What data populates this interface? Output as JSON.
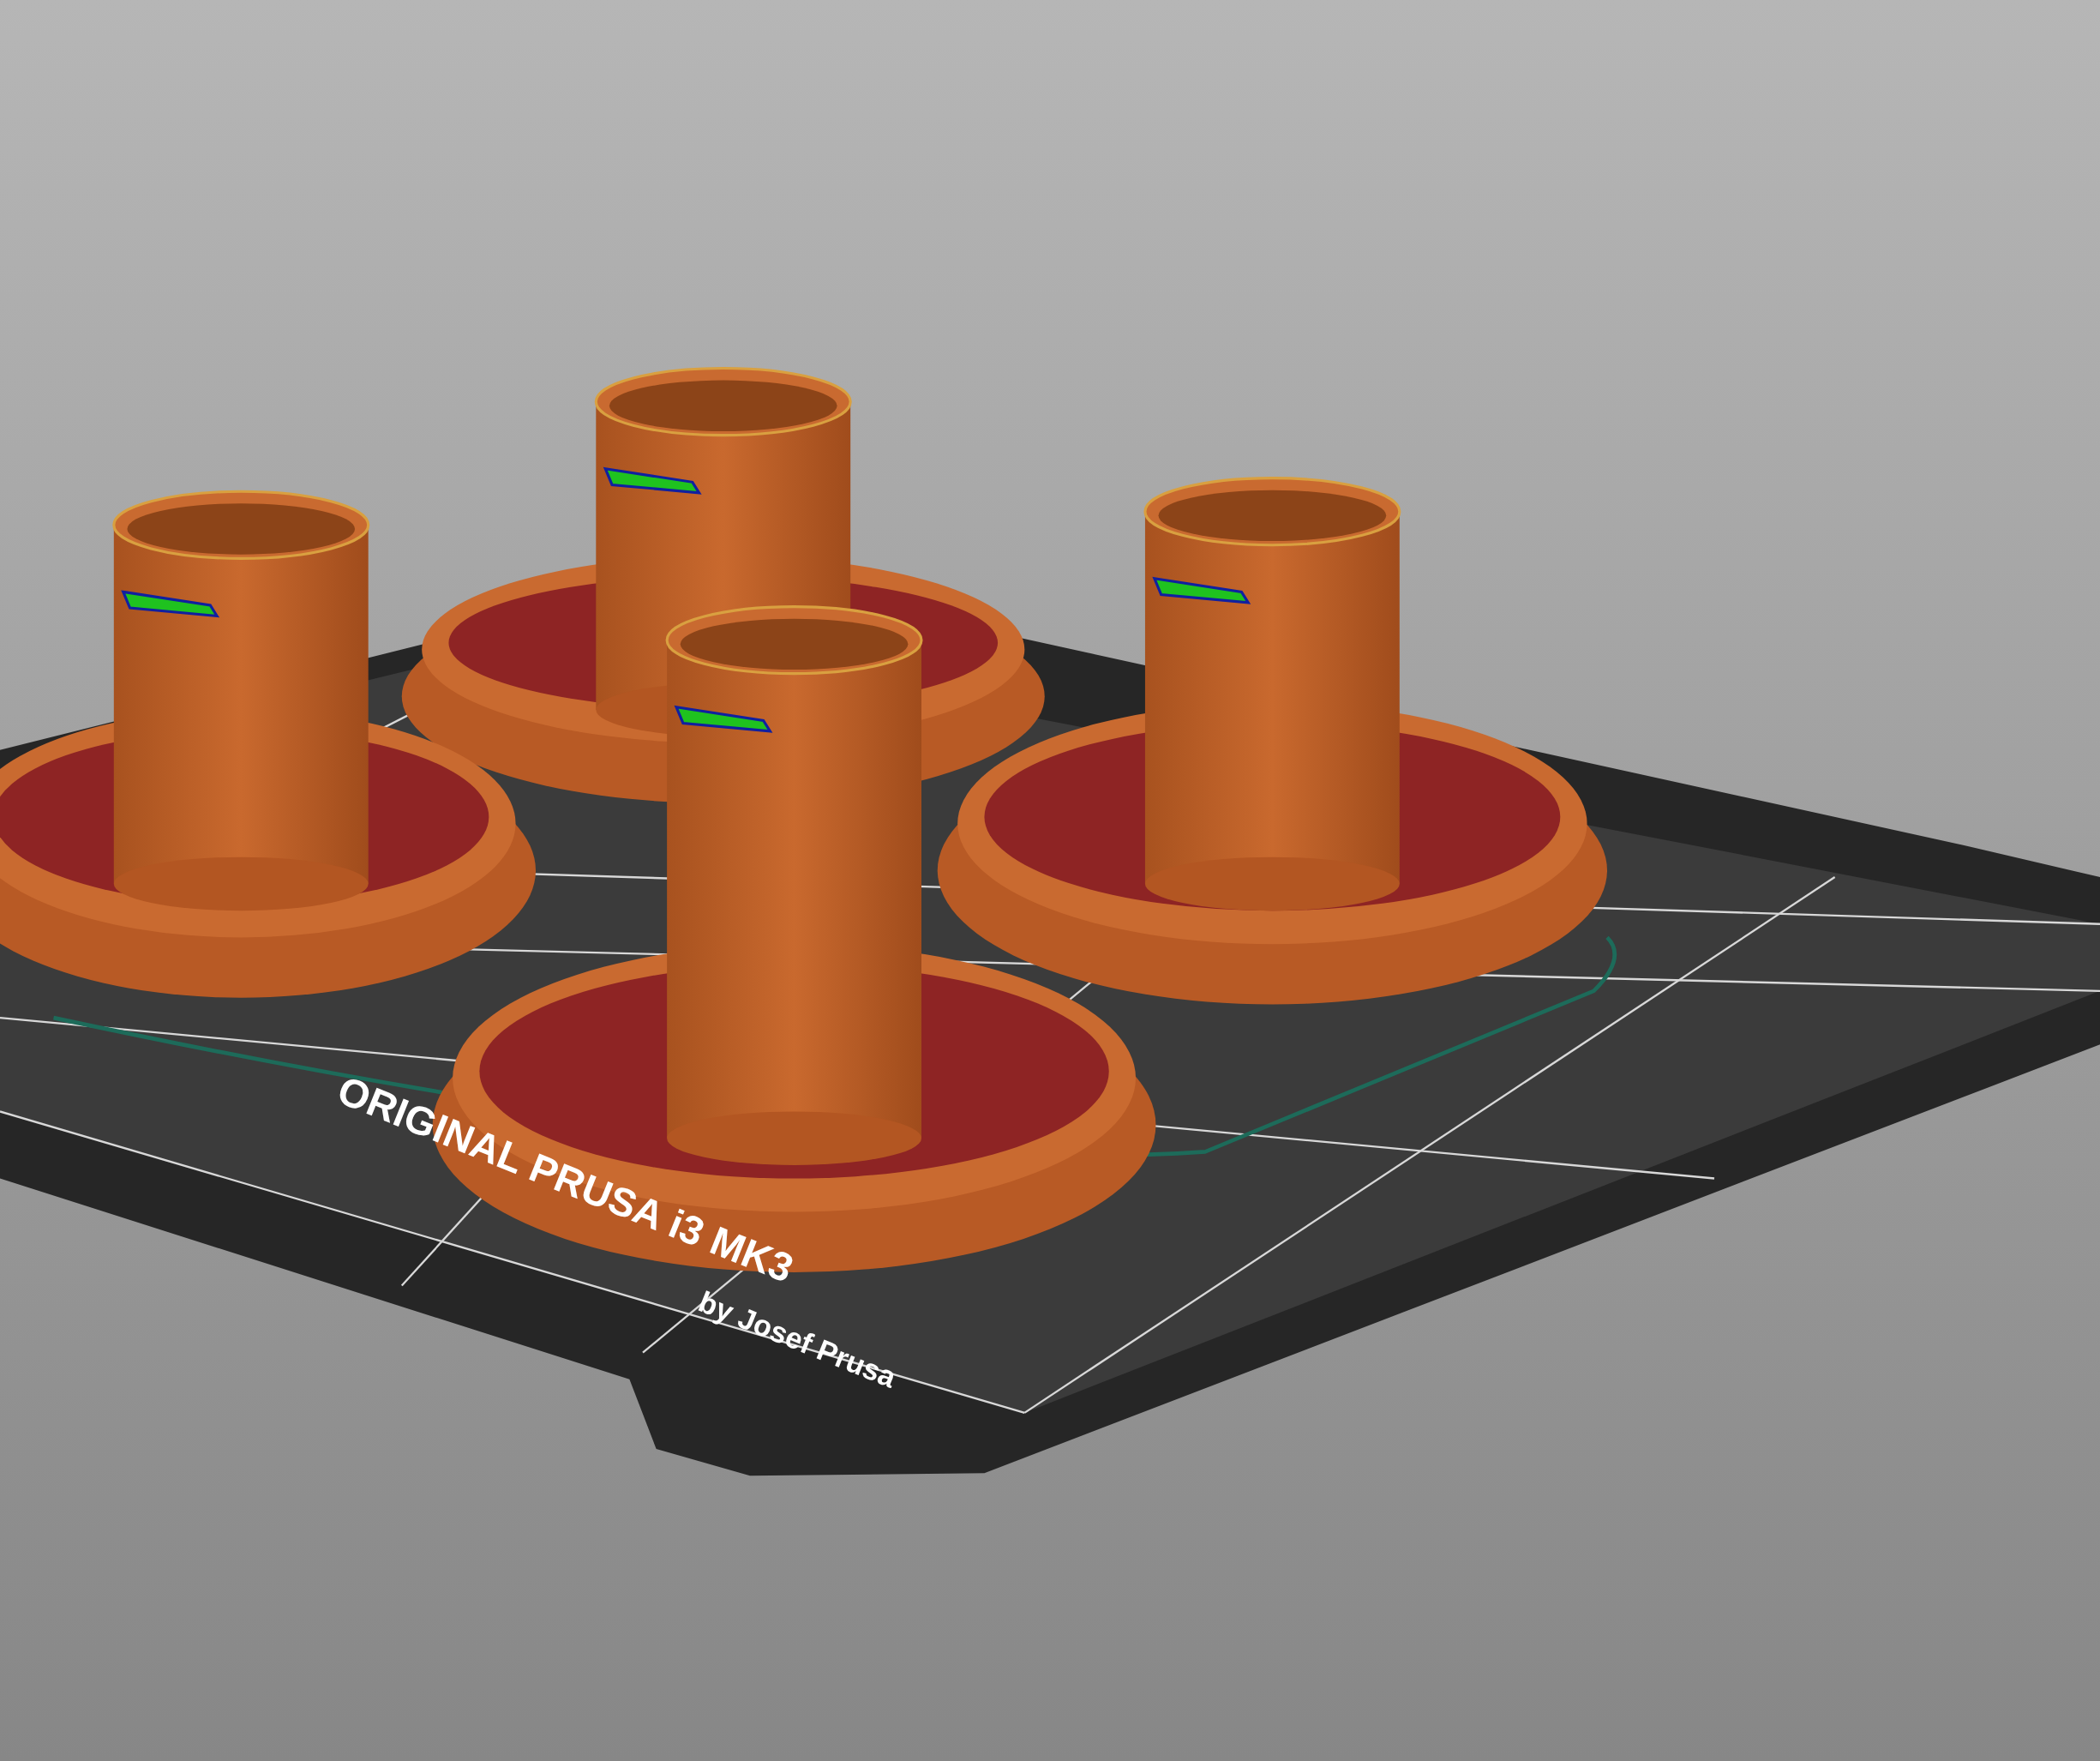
{
  "viewport": {
    "bed_logo": [
      {
        "text": "ORIGINAL PRUSA i3 MK3"
      },
      {
        "text": "by Josef Prusa"
      }
    ]
  }
}
